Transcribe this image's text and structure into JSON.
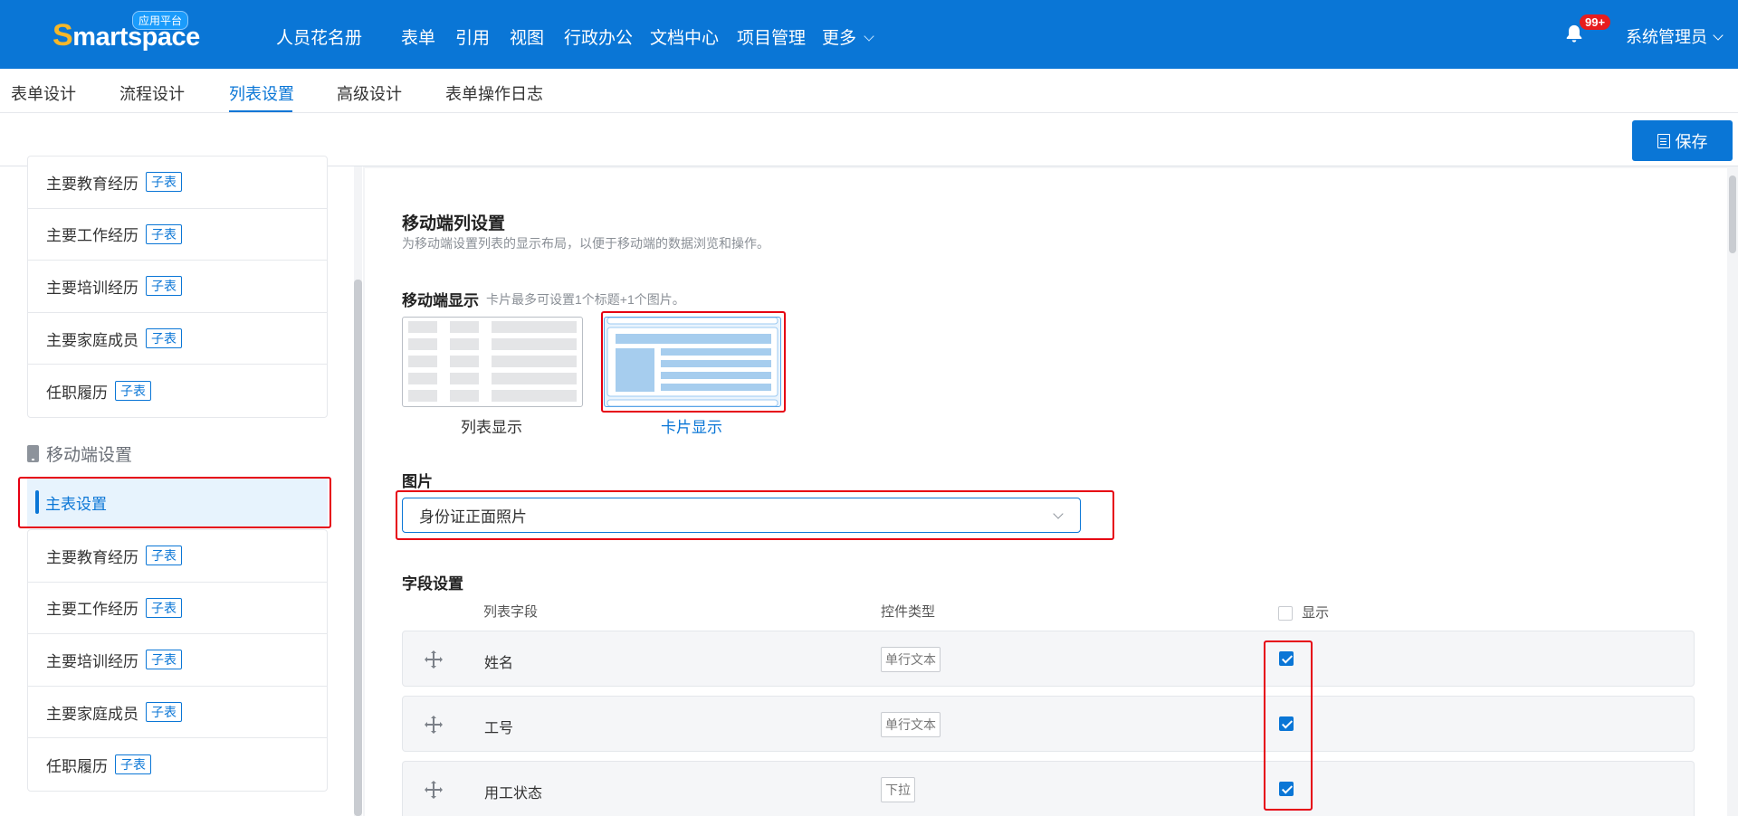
{
  "topbar": {
    "logo_first": "S",
    "logo_rest": "martspace",
    "logo_badge": "应用平台",
    "nav": [
      "人员花名册",
      "表单",
      "引用",
      "视图",
      "行政办公",
      "文档中心",
      "项目管理",
      "更多"
    ],
    "notification_count": "99+",
    "user": "系统管理员"
  },
  "tabs": [
    "表单设计",
    "流程设计",
    "列表设置",
    "高级设计",
    "表单操作日志"
  ],
  "active_tab": "列表设置",
  "toolbar": {
    "save_label": "保存"
  },
  "sidebar": {
    "sub_tag": "子表",
    "top_items": [
      "主要教育经历",
      "主要工作经历",
      "主要培训经历",
      "主要家庭成员",
      "任职履历"
    ],
    "mobile_section_title": "移动端设置",
    "mobile_selected": "主表设置",
    "mobile_items": [
      "主要教育经历",
      "主要工作经历",
      "主要培训经历",
      "主要家庭成员",
      "任职履历"
    ]
  },
  "main": {
    "title": "移动端列设置",
    "description": "为移动端设置列表的显示布局，以便于移动端的数据浏览和操作。",
    "display_label": "移动端显示",
    "display_hint": "卡片最多可设置1个标题+1个图片。",
    "layout_list_label": "列表显示",
    "layout_card_label": "卡片显示",
    "selected_layout": "卡片显示",
    "image_label": "图片",
    "image_value": "身份证正面照片",
    "field_settings_label": "字段设置",
    "columns": {
      "field": "列表字段",
      "type": "控件类型",
      "show": "显示"
    },
    "rows": [
      {
        "name": "姓名",
        "type": "单行文本",
        "show": true
      },
      {
        "name": "工号",
        "type": "单行文本",
        "show": true
      },
      {
        "name": "用工状态",
        "type": "下拉",
        "show": true
      }
    ]
  },
  "colors": {
    "primary": "#0a76d6",
    "highlight_box": "#e60012",
    "badge": "#e81d1d"
  }
}
